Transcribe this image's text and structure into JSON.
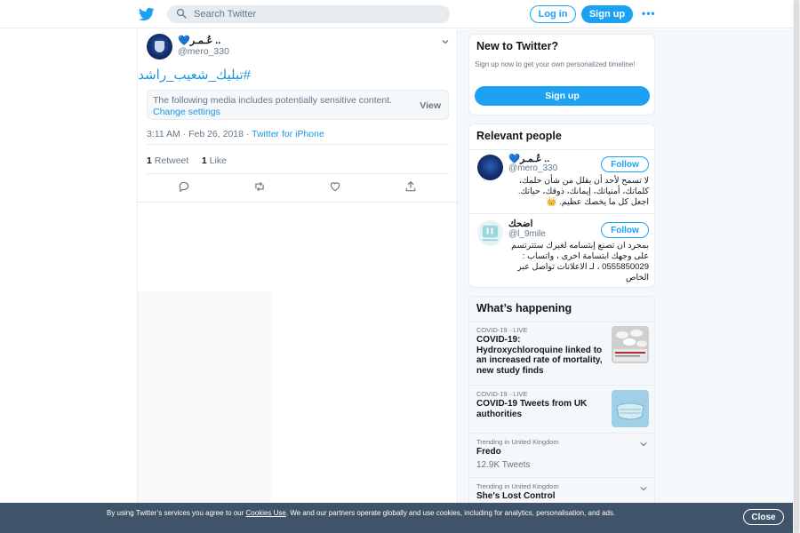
{
  "header": {
    "search_placeholder": "Search Twitter",
    "login_label": "Log in",
    "signup_label": "Sign up",
    "more_label": "•••"
  },
  "tweet": {
    "author_name": "عُـمـر ..",
    "author_heart": "💙",
    "author_handle": "@mero_330",
    "text": "#تبليك_شعيب_راشد",
    "sensitive_message": "The following media includes potentially sensitive content.",
    "change_settings": "Change settings",
    "view_label": "View",
    "time": "3:11 AM · Feb 26, 2018 · ",
    "source": "Twitter for iPhone",
    "retweet_count": "1",
    "retweet_label": "Retweet",
    "like_count": "1",
    "like_label": "Like"
  },
  "new_to_twitter": {
    "title": "New to Twitter?",
    "subtitle": "Sign up now to get your own personalized timeline!",
    "signup_label": "Sign up"
  },
  "relevant_people": {
    "title": "Relevant people",
    "people": [
      {
        "name": "عُـمـر ..",
        "heart": "💙",
        "handle": "@mero_330",
        "follow_label": "Follow",
        "bio": "لا تسمح لأحد أن يقلل من شأن حلمك، كلماتك، أمنياتك، إيمانك، ذوقك، حياتك. اجعل كل ما يخصك عظيم. 👑"
      },
      {
        "name": "اضحك",
        "handle": "@l_9mile",
        "follow_label": "Follow",
        "bio": "بمجرد ان تصنع إبتسامه لغيرك ستترتسم على وجهك ابتسامة اخرى ، واتساب : 0555850029 ، لـ الاعلانات تواصل عبر الخاص"
      }
    ]
  },
  "whats_happening": {
    "title": "What’s happening",
    "trends": [
      {
        "meta": "COVID-19 · LIVE",
        "title": "COVID-19: Hydroxychloroquine linked to an increased rate of mortality, new study finds"
      },
      {
        "meta": "COVID-19 · LIVE",
        "title": "COVID-19 Tweets from UK authorities"
      },
      {
        "meta": "Trending in United Kingdom",
        "title": "Fredo",
        "count": "12.9K Tweets"
      },
      {
        "meta": "Trending in United Kingdom",
        "title": "She's Lost Control"
      }
    ]
  },
  "cookie_banner": {
    "text_before": "By using Twitter’s services you agree to our ",
    "link": "Cookies Use",
    "text_after": ". We and our partners operate globally and use cookies, including for analytics, personalisation, and ads.",
    "close_label": "Close"
  },
  "colors": {
    "brand": "#1da1f2",
    "link": "#1b95e0",
    "muted": "#657786"
  }
}
